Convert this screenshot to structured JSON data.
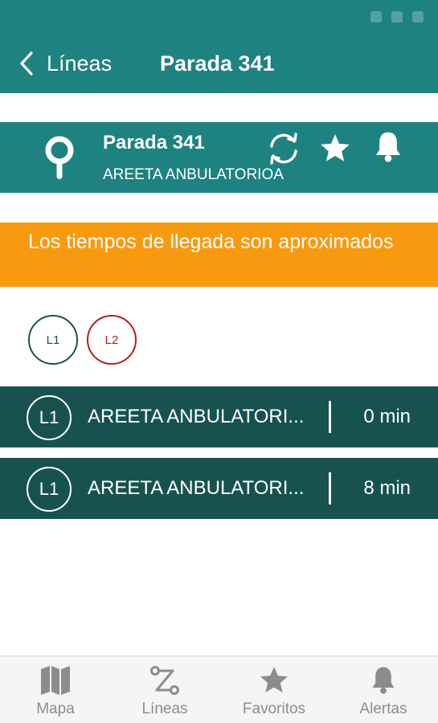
{
  "header": {
    "back_label": "Líneas",
    "title": "Parada 341"
  },
  "stop": {
    "name": "Parada 341",
    "location": "AREETA ANBULATORIOA",
    "icons": [
      "map-pin-icon",
      "refresh-icon",
      "star-icon",
      "bell-icon"
    ]
  },
  "notice": {
    "text": "Los tiempos de llegada son aproximados"
  },
  "line_filters": [
    {
      "label": "L1",
      "color": "#17524f"
    },
    {
      "label": "L2",
      "color": "#b71c1c"
    }
  ],
  "arrivals": [
    {
      "line": "L1",
      "destination": "AREETA ANBULATORI...",
      "time": "0 min"
    },
    {
      "line": "L1",
      "destination": "AREETA ANBULATORI...",
      "time": "8 min"
    }
  ],
  "tabs": [
    {
      "label": "Mapa",
      "icon": "map-icon"
    },
    {
      "label": "Líneas",
      "icon": "route-icon"
    },
    {
      "label": "Favoritos",
      "icon": "star-icon"
    },
    {
      "label": "Alertas",
      "icon": "bell-icon"
    }
  ],
  "colors": {
    "primary": "#1e8281",
    "dark": "#17524f",
    "notice": "#f89a10",
    "line_l2": "#b71c1c",
    "tab_inactive": "#8c8c8c"
  }
}
